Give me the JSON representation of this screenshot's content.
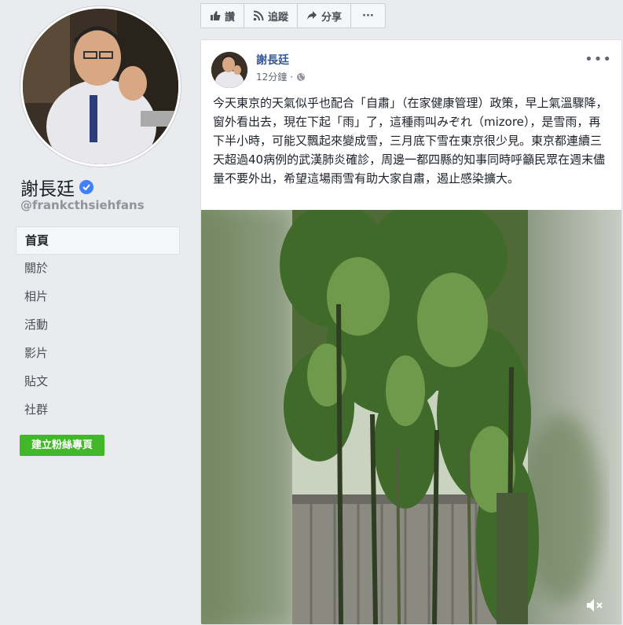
{
  "sidebar": {
    "page_name": "謝長廷",
    "handle": "@frankcthsiehfans",
    "nav_items": [
      "首頁",
      "關於",
      "相片",
      "活動",
      "影片",
      "貼文",
      "社群"
    ],
    "create_button": "建立粉絲專頁"
  },
  "actionbar": {
    "like": "讚",
    "follow": "追蹤",
    "share": "分享",
    "more": "···"
  },
  "post": {
    "author": "謝長廷",
    "time": "12分鐘",
    "separator": "·",
    "more": "•••",
    "text": "今天東京的天氣似乎也配合「自肅」（在家健康管理）政策，早上氣溫驟降，窗外看出去，現在下起「雨」了，這種雨叫みぞれ（mizore），是雪雨，再下半小時，可能又飄起來變成雪，三月底下雪在東京很少見。東京都連續三天超過40病例的武漢肺炎確診，周邊一都四縣的知事同時呼籲民眾在週末儘量不要外出，希望這場雨雪有助大家自肅，遏止感染擴大。"
  },
  "colors": {
    "link": "#365899",
    "green_button": "#42b72a",
    "verified": "#4080ff",
    "background": "#e9ebee"
  },
  "icons": [
    "like-icon",
    "rss-icon",
    "share-icon",
    "globe-icon",
    "verified-badge-icon",
    "mute-icon"
  ]
}
